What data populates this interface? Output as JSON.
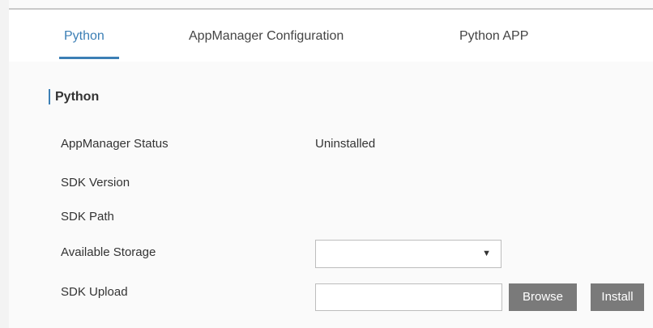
{
  "tabs": [
    {
      "label": "Python",
      "active": true
    },
    {
      "label": "AppManager Configuration",
      "active": false
    },
    {
      "label": "Python APP",
      "active": false
    }
  ],
  "section": {
    "title": "Python"
  },
  "fields": {
    "appmanager_status": {
      "label": "AppManager Status",
      "value": "Uninstalled"
    },
    "sdk_version": {
      "label": "SDK Version",
      "value": ""
    },
    "sdk_path": {
      "label": "SDK Path",
      "value": ""
    },
    "available_storage": {
      "label": "Available Storage",
      "selected": ""
    },
    "sdk_upload": {
      "label": "SDK Upload",
      "value": ""
    }
  },
  "buttons": {
    "browse": "Browse",
    "install": "Install"
  },
  "icons": {
    "dropdown": "dropdown-triangle-icon"
  },
  "colors": {
    "accent": "#3c7fb5",
    "button": "#7a7a7a",
    "background": "#f3f3f3",
    "panel": "#fafafa"
  }
}
